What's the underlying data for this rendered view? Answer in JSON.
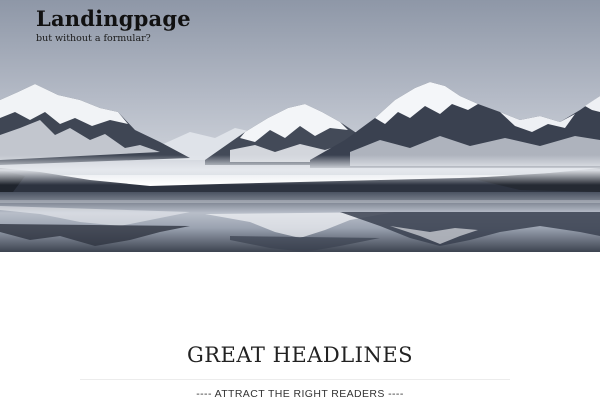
{
  "header": {
    "site_title": "Landingpage",
    "tagline": "but without a formular?"
  },
  "hero": {
    "image_subject": "snowy-mountain-lake-reflection",
    "colors": {
      "sky_top": "#8f98a8",
      "sky_bottom": "#c9ced7",
      "snow": "#f2f4f7",
      "rock": "#3b4250",
      "water": "#2c3340"
    }
  },
  "main": {
    "headline": "GREAT HEADLINES",
    "subheadline": "---- ATTRACT THE RIGHT READERS ----"
  }
}
